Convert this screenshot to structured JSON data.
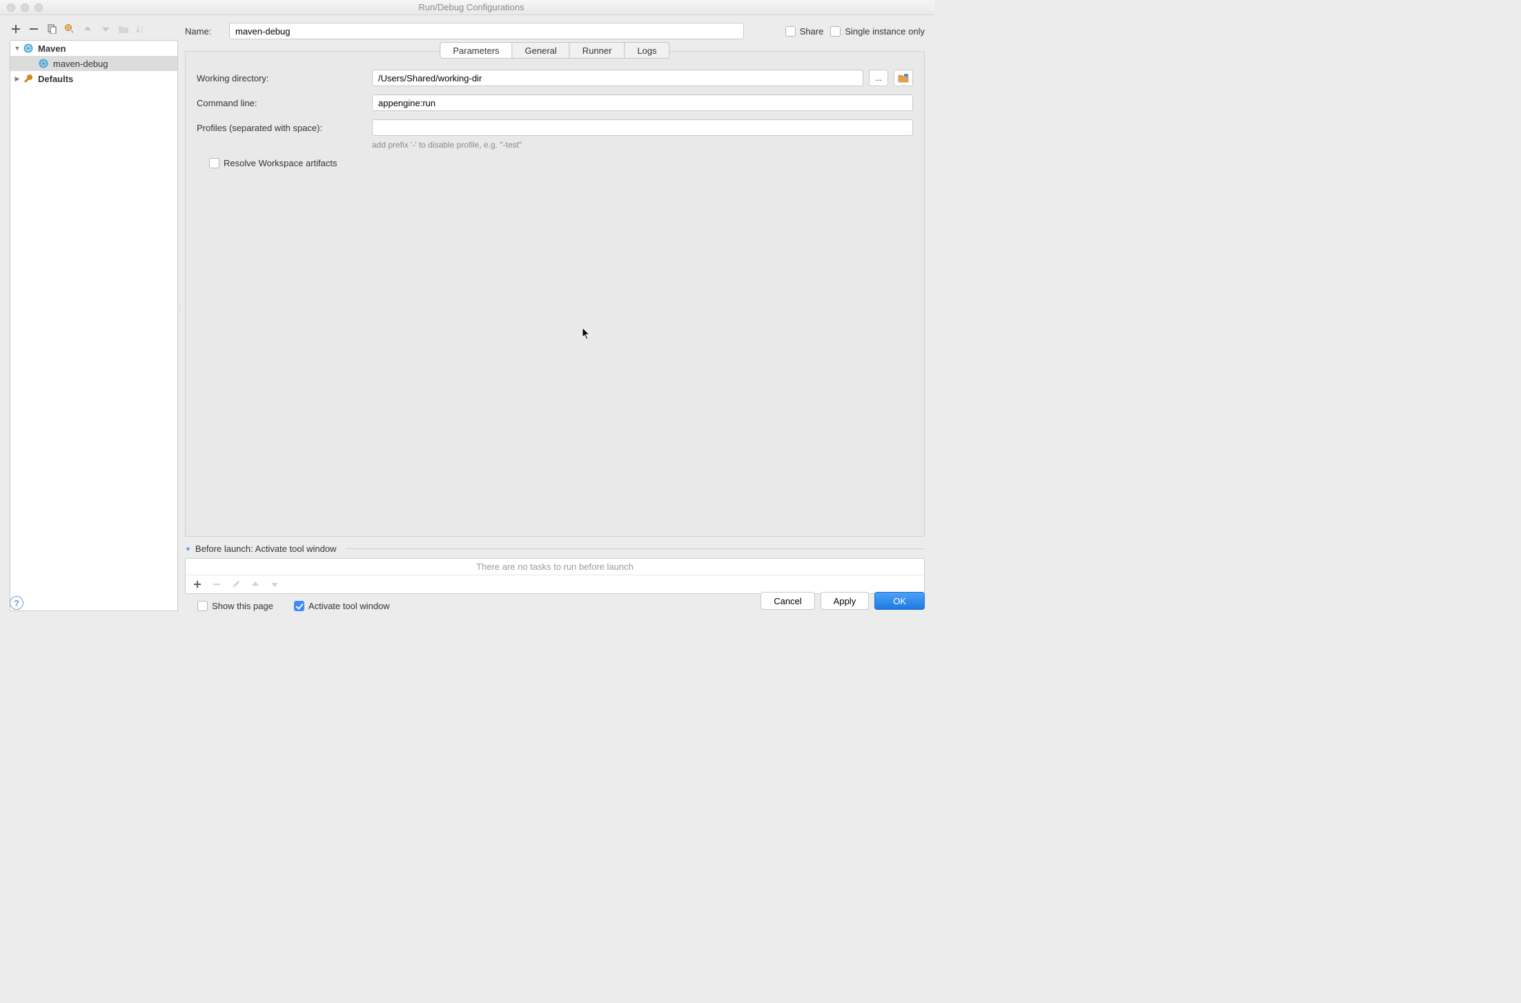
{
  "window": {
    "title": "Run/Debug Configurations"
  },
  "name_row": {
    "label": "Name:",
    "value": "maven-debug"
  },
  "header_checks": {
    "share": "Share",
    "single": "Single instance only"
  },
  "tree": {
    "maven": "Maven",
    "maven_child": "maven-debug",
    "defaults": "Defaults"
  },
  "tabs": {
    "parameters": "Parameters",
    "general": "General",
    "runner": "Runner",
    "logs": "Logs"
  },
  "form": {
    "working_dir_label": "Working directory:",
    "working_dir_value": "/Users/Shared/working-dir",
    "cmd_label": "Command line:",
    "cmd_value": "appengine:run",
    "profiles_label": "Profiles (separated with space):",
    "profiles_value": "",
    "profiles_hint": "add prefix '-' to disable profile, e.g. \"-test\"",
    "resolve_label": "Resolve Workspace artifacts"
  },
  "before_launch": {
    "header": "Before launch: Activate tool window",
    "empty": "There are no tasks to run before launch",
    "show_page": "Show this page",
    "activate": "Activate tool window"
  },
  "buttons": {
    "cancel": "Cancel",
    "apply": "Apply",
    "ok": "OK"
  },
  "browse_ellipsis": "..."
}
